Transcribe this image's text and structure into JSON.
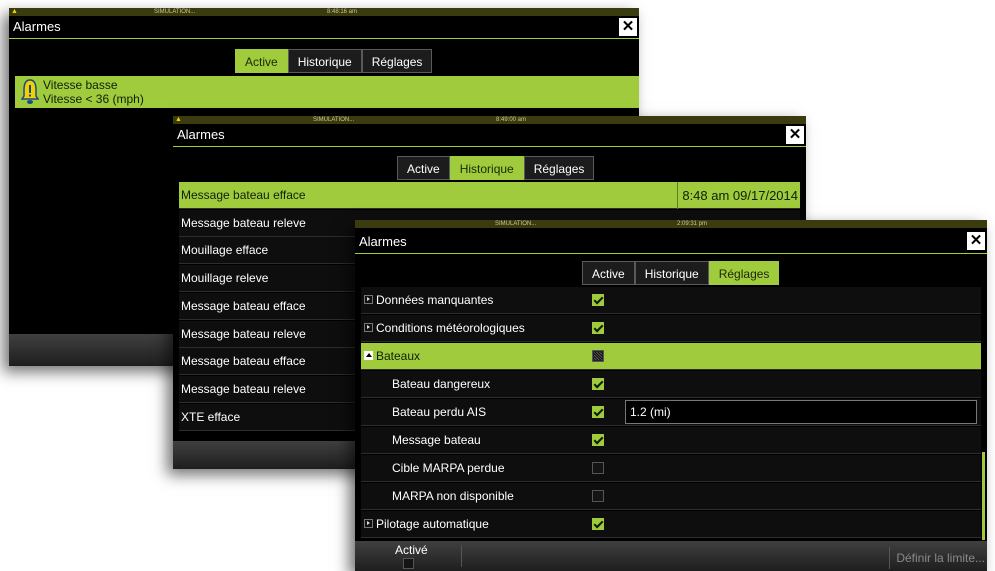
{
  "colors": {
    "accent": "#9fcb3c",
    "window_bg": "#000000",
    "status_bar": "#3b3b10",
    "alarm_icon": "#f2d000"
  },
  "window_active": {
    "status_sim": "SIMULATION...",
    "clock": "8:48:16 am",
    "title": "Alarmes",
    "close_icon": "close-icon",
    "tabs": [
      "Active",
      "Historique",
      "Réglages"
    ],
    "alarm": {
      "icon": "bell-warning-icon",
      "title": "Vitesse basse",
      "detail": "Vitesse < 36 (mph)"
    }
  },
  "window_history": {
    "status_sim": "SIMULATION...",
    "clock": "8:49:00 am",
    "title": "Alarmes",
    "tabs": [
      "Active",
      "Historique",
      "Réglages"
    ],
    "selected_time": "8:48 am 09/17/2014",
    "rows": [
      "Message bateau efface",
      "Message bateau releve",
      "Mouillage efface",
      "Mouillage releve",
      "Message bateau efface",
      "Message bateau releve",
      "Message bateau efface",
      "Message bateau releve",
      "XTE efface"
    ]
  },
  "window_settings": {
    "status_sim": "SIMULATION...",
    "clock": "2:09:31 pm",
    "title": "Alarmes",
    "tabs": [
      "Active",
      "Historique",
      "Réglages"
    ],
    "rows": [
      {
        "label": "Données manquantes",
        "state": "on",
        "type": "group-collapsed"
      },
      {
        "label": "Conditions météorologiques",
        "state": "on",
        "type": "group-collapsed"
      },
      {
        "label": "Bateaux",
        "state": "partial",
        "type": "group-expanded"
      },
      {
        "label": "Bateau dangereux",
        "state": "on",
        "type": "child"
      },
      {
        "label": "Bateau perdu AIS",
        "state": "on",
        "type": "child",
        "value": "1.2 (mi)"
      },
      {
        "label": "Message bateau",
        "state": "on",
        "type": "child"
      },
      {
        "label": "Cible MARPA perdue",
        "state": "off",
        "type": "child"
      },
      {
        "label": "MARPA non disponible",
        "state": "off",
        "type": "child"
      },
      {
        "label": "Pilotage automatique",
        "state": "on",
        "type": "group-collapsed"
      }
    ],
    "footer": {
      "enabled_label": "Activé",
      "limit_button": "Définir la limite..."
    }
  }
}
